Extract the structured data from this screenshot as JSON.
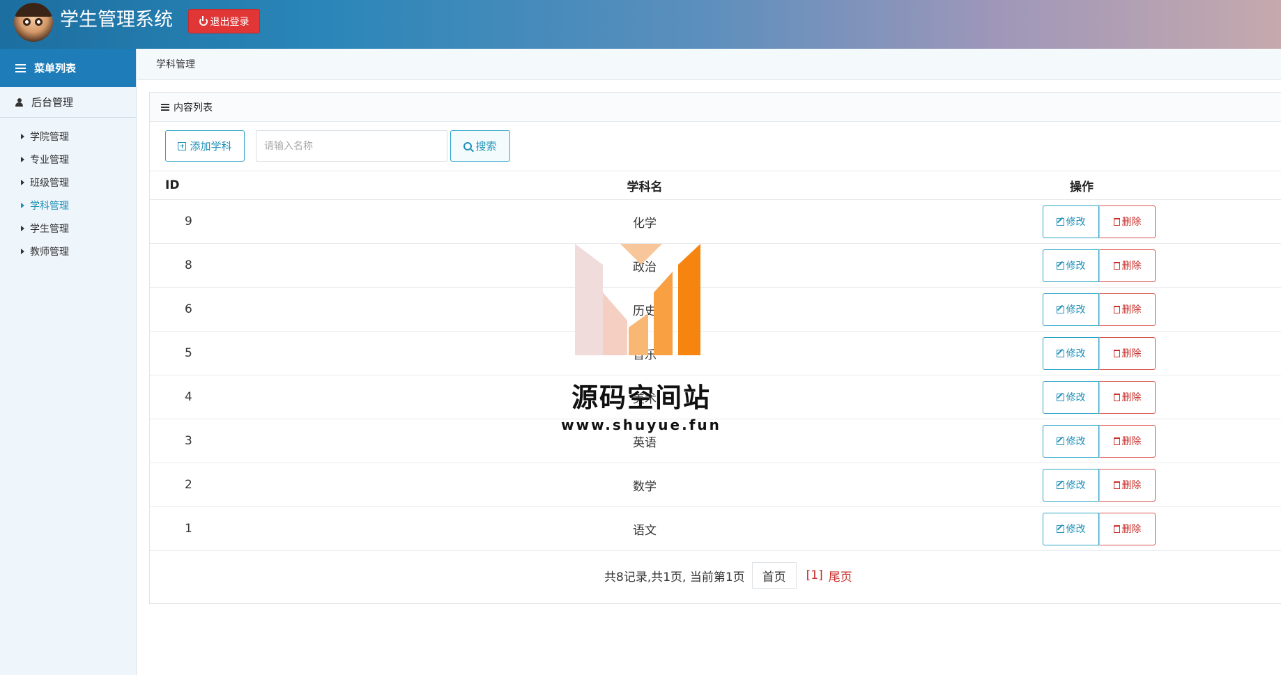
{
  "header": {
    "title": "学生管理系统",
    "logout_label": "退出登录"
  },
  "sidebar": {
    "menu_title": "菜单列表",
    "group_title": "后台管理",
    "items": [
      {
        "label": "学院管理"
      },
      {
        "label": "专业管理"
      },
      {
        "label": "班级管理"
      },
      {
        "label": "学科管理"
      },
      {
        "label": "学生管理"
      },
      {
        "label": "教师管理"
      }
    ],
    "active_index": 3
  },
  "breadcrumb": "学科管理",
  "panel": {
    "title": "内容列表",
    "add_label": "添加学科",
    "search_placeholder": "请输入名称",
    "search_label": "搜索"
  },
  "table": {
    "columns": [
      "ID",
      "学科名",
      "操作"
    ],
    "rows": [
      {
        "id": "9",
        "name": "化学"
      },
      {
        "id": "8",
        "name": "政治"
      },
      {
        "id": "6",
        "name": "历史"
      },
      {
        "id": "5",
        "name": "音乐"
      },
      {
        "id": "4",
        "name": "美术"
      },
      {
        "id": "3",
        "name": "英语"
      },
      {
        "id": "2",
        "name": "数学"
      },
      {
        "id": "1",
        "name": "语文"
      }
    ],
    "edit_label": "修改",
    "delete_label": "删除"
  },
  "pager": {
    "summary": "共8记录,共1页, 当前第1页",
    "first_label": "首页",
    "current_page": "[1]",
    "last_label": "尾页"
  },
  "watermark": {
    "title": "源码空间站",
    "url": "www.shuyue.fun"
  },
  "colors": {
    "header_start": "#1c6fa0",
    "sidebar_head": "#1e7db8",
    "accent": "#1e90b8",
    "danger": "#c9302c",
    "logout": "#e03636"
  }
}
